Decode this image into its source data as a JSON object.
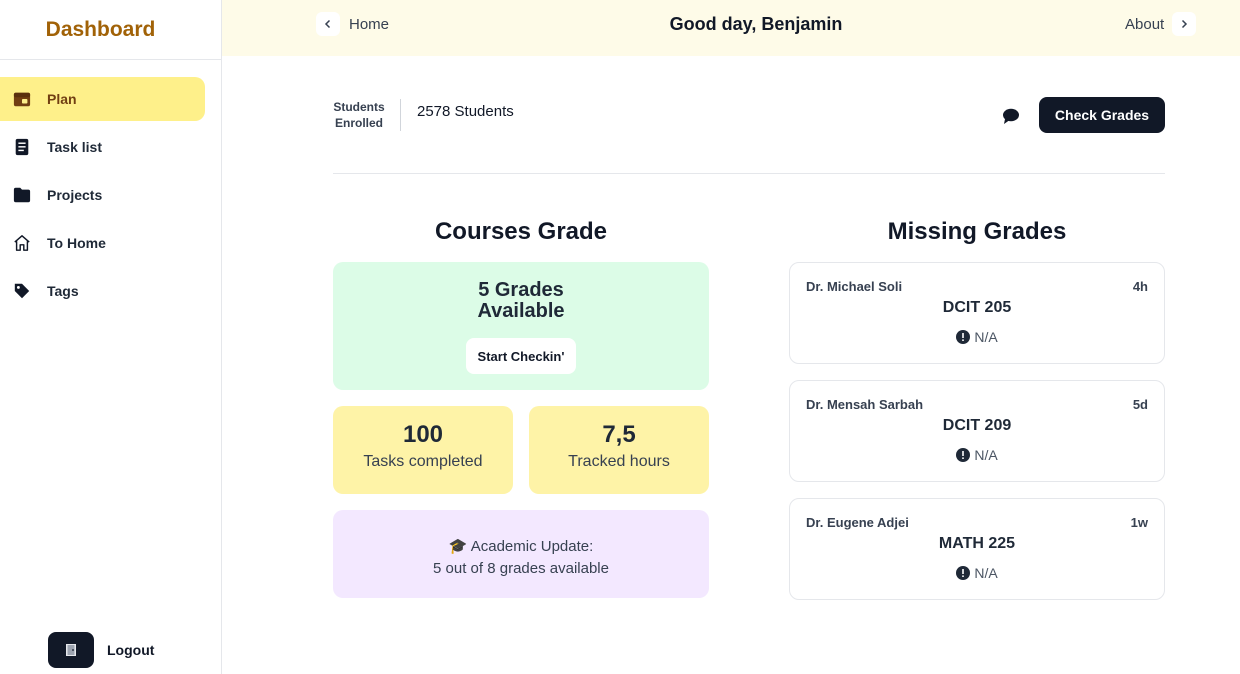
{
  "sidebar": {
    "brand": "Dashboard",
    "items": [
      {
        "label": "Plan",
        "icon": "calendar-icon",
        "active": true
      },
      {
        "label": "Task list",
        "icon": "document-icon",
        "active": false
      },
      {
        "label": "Projects",
        "icon": "folder-icon",
        "active": false
      },
      {
        "label": "To Home",
        "icon": "home-icon",
        "active": false
      },
      {
        "label": "Tags",
        "icon": "tag-icon",
        "active": false
      }
    ],
    "logout_label": "Logout"
  },
  "topbar": {
    "back_label": "Home",
    "greeting": "Good day, Benjamin",
    "about_label": "About"
  },
  "summary": {
    "enrolled_label": "Students Enrolled",
    "enrolled_value": "2578 Students",
    "check_button": "Check Grades"
  },
  "courses": {
    "title": "Courses Grade",
    "grades_available": "5 Grades Available",
    "start_button": "Start Checkin'",
    "stats": [
      {
        "value": "100",
        "label": "Tasks completed"
      },
      {
        "value": "7,5",
        "label": "Tracked hours"
      }
    ],
    "update_title": "🎓 Academic Update:",
    "update_text": "5 out of 8 grades available"
  },
  "missing": {
    "title": "Missing Grades",
    "items": [
      {
        "name": "Dr. Michael Soli",
        "time": "4h",
        "course": "DCIT 205",
        "status": "N/A"
      },
      {
        "name": "Dr. Mensah Sarbah",
        "time": "5d",
        "course": "DCIT 209",
        "status": "N/A"
      },
      {
        "name": "Dr. Eugene Adjei",
        "time": "1w",
        "course": "MATH 225",
        "status": "N/A"
      }
    ]
  },
  "colors": {
    "brand": "#a16207",
    "active_nav": "#fef08a",
    "topbar_bg": "#fefbe8",
    "dark": "#111827",
    "green_card": "#dcfce7",
    "yellow_card": "#fef3a7",
    "purple_card": "#f3e8ff"
  }
}
